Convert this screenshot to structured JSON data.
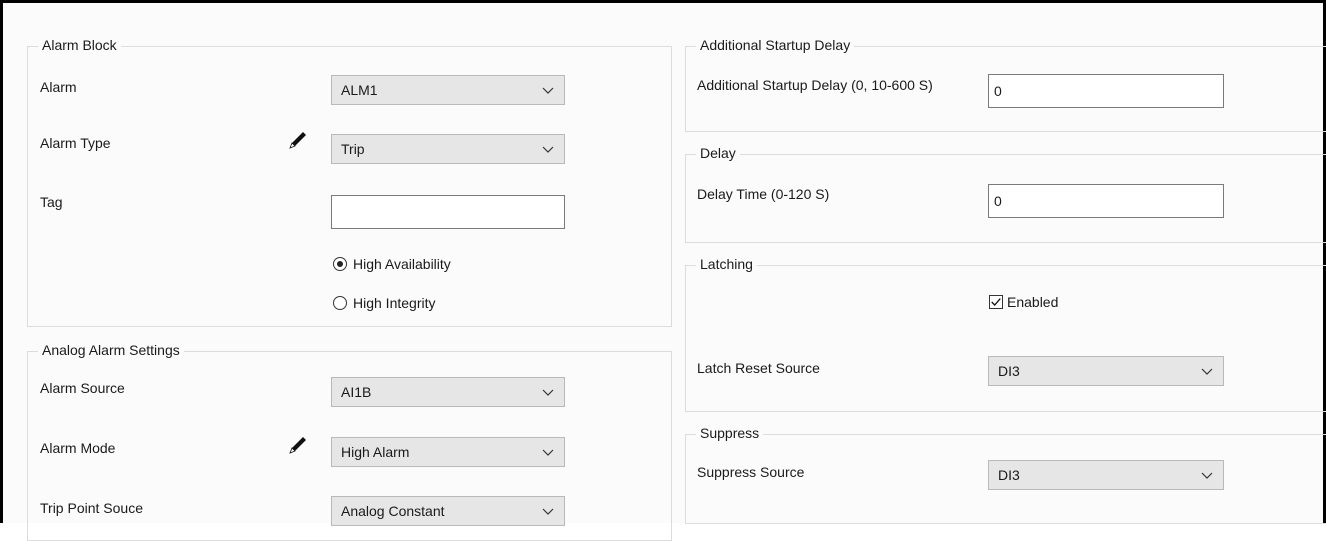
{
  "alarm_block": {
    "title": "Alarm Block",
    "alarm_label": "Alarm",
    "alarm_value": "ALM1",
    "alarm_type_label": "Alarm Type",
    "alarm_type_value": "Trip",
    "tag_label": "Tag",
    "tag_value": "",
    "radio_high_availability": "High Availability",
    "radio_high_integrity": "High Integrity",
    "selected_radio": "High Availability"
  },
  "analog_alarm_settings": {
    "title": "Analog Alarm Settings",
    "alarm_source_label": "Alarm Source",
    "alarm_source_value": "AI1B",
    "alarm_mode_label": "Alarm Mode",
    "alarm_mode_value": "High Alarm",
    "trip_point_label": "Trip Point Souce",
    "trip_point_value": "Analog Constant"
  },
  "additional_startup_delay": {
    "title": "Additional Startup Delay",
    "label": "Additional Startup Delay (0, 10-600 S)",
    "value": "0"
  },
  "delay": {
    "title": "Delay",
    "label": "Delay Time (0-120 S)",
    "value": "0"
  },
  "latching": {
    "title": "Latching",
    "enabled_label": "Enabled",
    "enabled_checked": true,
    "reset_source_label": "Latch Reset Source",
    "reset_source_value": "DI3"
  },
  "suppress": {
    "title": "Suppress",
    "source_label": "Suppress Source",
    "source_value": "DI3"
  },
  "icons": {
    "dropdown": "chevron-down-icon",
    "edit": "pencil-icon",
    "check": "checkmark-icon"
  }
}
